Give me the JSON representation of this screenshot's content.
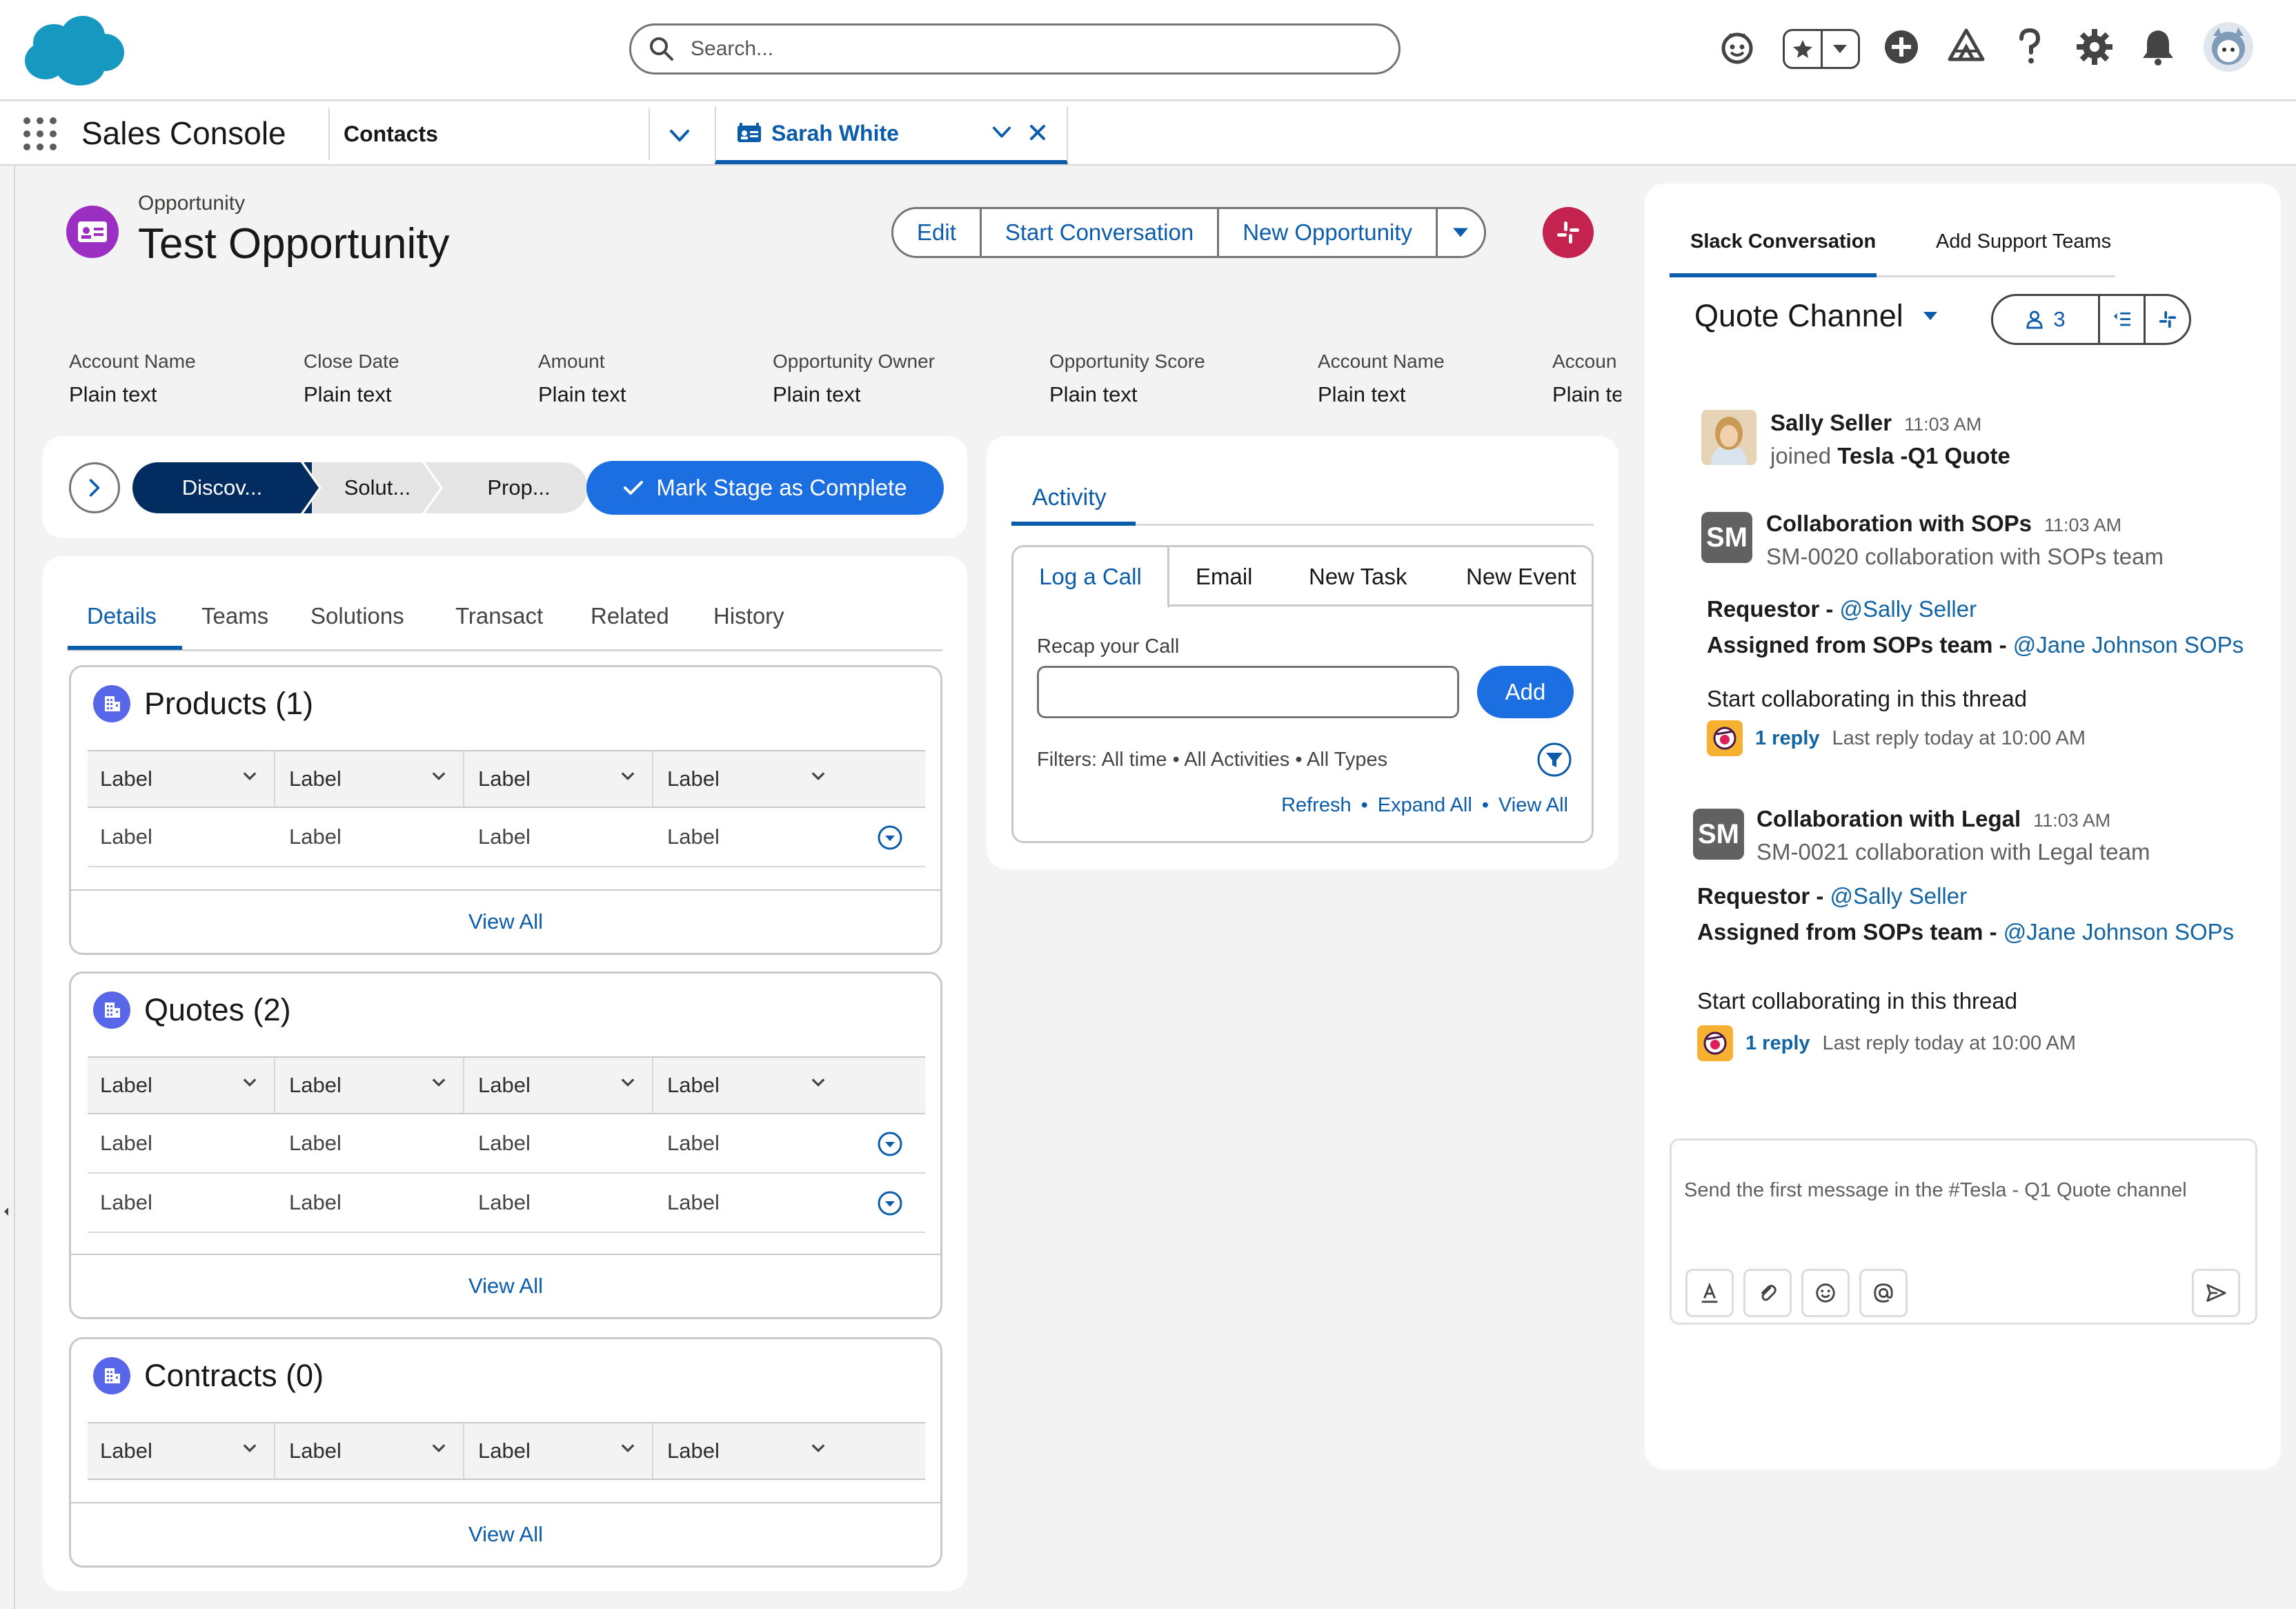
{
  "header": {
    "search_placeholder": "Search...",
    "icons": [
      "einstein-icon",
      "favorites-star-icon",
      "favorites-dropdown-icon",
      "add-icon",
      "trailhead-icon",
      "help-icon",
      "setup-gear-icon",
      "notifications-bell-icon",
      "user-avatar-icon"
    ]
  },
  "nav": {
    "app_name": "Sales Console",
    "object_tab": "Contacts",
    "active_tab": "Sarah White"
  },
  "record": {
    "type": "Opportunity",
    "title": "Test Opportunity",
    "actions": [
      "Edit",
      "Start Conversation",
      "New Opportunity"
    ]
  },
  "highlights": [
    {
      "label": "Account Name",
      "value": "Plain text"
    },
    {
      "label": "Close Date",
      "value": "Plain text"
    },
    {
      "label": "Amount",
      "value": "Plain text"
    },
    {
      "label": "Opportunity Owner",
      "value": "Plain text"
    },
    {
      "label": "Opportunity Score",
      "value": "Plain text"
    },
    {
      "label": "Account Name",
      "value": "Plain text"
    },
    {
      "label": "Accoun",
      "value": "Plain te"
    }
  ],
  "path": {
    "steps": [
      "Discov...",
      "Solut...",
      "Prop..."
    ],
    "mark_complete": "Mark Stage as Complete"
  },
  "details": {
    "tabs": [
      "Details",
      "Teams",
      "Solutions",
      "Transact",
      "Related",
      "History"
    ],
    "related_lists": [
      {
        "title": "Products (1)",
        "columns": [
          "Label",
          "Label",
          "Label",
          "Label"
        ],
        "rows": [
          [
            "Label",
            "Label",
            "Label",
            "Label"
          ]
        ],
        "footer": "View All"
      },
      {
        "title": "Quotes (2)",
        "columns": [
          "Label",
          "Label",
          "Label",
          "Label"
        ],
        "rows": [
          [
            "Label",
            "Label",
            "Label",
            "Label"
          ],
          [
            "Label",
            "Label",
            "Label",
            "Label"
          ]
        ],
        "footer": "View All"
      },
      {
        "title": "Contracts (0)",
        "columns": [
          "Label",
          "Label",
          "Label",
          "Label"
        ],
        "rows": [],
        "footer": "View All"
      }
    ]
  },
  "activity": {
    "title": "Activity",
    "publisher_tabs": [
      "Log a Call",
      "Email",
      "New Task",
      "New Event"
    ],
    "recap_label": "Recap your Call",
    "add_label": "Add",
    "filters": "Filters: All time  •  All Activities  • All Types",
    "links": [
      "Refresh",
      "Expand All",
      "View All"
    ]
  },
  "slack": {
    "tabs": [
      "Slack Conversation",
      "Add Support Teams"
    ],
    "channel": "Quote Channel",
    "member_count": "3",
    "messages": [
      {
        "author": "Sally Seller",
        "time": "11:03 AM",
        "line_prefix": "joined ",
        "line_bold": "Tesla -Q1 Quote"
      },
      {
        "avatar": "SM",
        "author": "Collaboration with SOPs",
        "time": "11:03 AM",
        "subtitle": "SM-0020 collaboration with SOPs team",
        "requestor_label": "Requestor -",
        "requestor": "@Sally Seller",
        "assigned_label": "Assigned from SOPs team -",
        "assigned": "@Jane Johnson SOPs",
        "cta": "Start collaborating in this thread",
        "reply_count": "1 reply",
        "reply_last": "Last reply today at 10:00 AM"
      },
      {
        "avatar": "SM",
        "author": "Collaboration with Legal",
        "time": "11:03 AM",
        "subtitle": "SM-0021 collaboration with Legal team",
        "requestor_label": "Requestor -",
        "requestor": "@Sally Seller",
        "assigned_label": "Assigned from SOPs team -",
        "assigned": "@Jane Johnson SOPs",
        "cta": "Start collaborating in this thread",
        "reply_count": "1 reply",
        "reply_last": "Last reply today at 10:00 AM"
      }
    ],
    "composer_placeholder": "Send the first message in the #Tesla - Q1 Quote channel"
  },
  "colors": {
    "brand_blue": "#0b5cab",
    "button_blue": "#1b6fe0",
    "path_active": "#032d60",
    "record_icon": "#9b2fc1",
    "slack_red": "#c4224f",
    "related_icon": "#5867e8",
    "slack_link": "#1264a3"
  }
}
